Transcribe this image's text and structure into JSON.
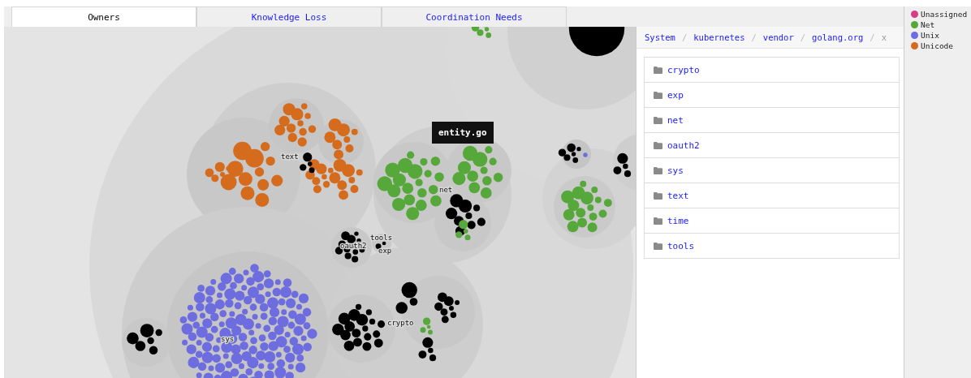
{
  "tabs": [
    {
      "label": "Owners",
      "selected": true
    },
    {
      "label": "Knowledge Loss",
      "selected": false
    },
    {
      "label": "Coordination Needs",
      "selected": false
    }
  ],
  "canvas": {
    "clusters": [
      {
        "color": "#d56b1c"
      },
      {
        "color": "#d56b1c"
      },
      {
        "color": "#d56b1c"
      },
      {
        "color": "#d56b1c"
      },
      {
        "color": "#d56b1c"
      },
      {
        "color": "#d56b1c"
      },
      {
        "color": "#000000"
      },
      {
        "color": "#56a83a"
      },
      {
        "color": "#56a83a"
      },
      {
        "color": "#000000"
      },
      {
        "color": "#56a83a"
      },
      {
        "color": "#000000"
      },
      {
        "color": "#000000"
      },
      {
        "color": "#6d6de0"
      },
      {
        "color": "#000000"
      },
      {
        "color": "#000000"
      },
      {
        "color": "#000000"
      },
      {
        "color": "#000000"
      },
      {
        "color": "#56a83a"
      },
      {
        "color": "#000000"
      },
      {
        "color": "#000000"
      },
      {
        "color": "#56a83a"
      },
      {
        "color": "#000000"
      },
      {
        "color": "#56a83a"
      },
      {
        "color": "#000000"
      },
      {
        "color": "#6d6de0"
      }
    ],
    "labels": [
      "text",
      "net",
      "oauth2",
      "tools",
      "exp",
      "crypto",
      "sys"
    ],
    "tooltip": "entity.go"
  },
  "breadcrumb": {
    "items": [
      "System",
      "kubernetes",
      "vendor",
      "golang.org"
    ],
    "separator": "/",
    "close": "x"
  },
  "folders": [
    "crypto",
    "exp",
    "net",
    "oauth2",
    "sys",
    "text",
    "time",
    "tools"
  ],
  "legend": [
    {
      "name": "Unassigned",
      "color": "#d63d86"
    },
    {
      "name": "Net",
      "color": "#56a83a"
    },
    {
      "name": "Unix",
      "color": "#6d6de0"
    },
    {
      "name": "Unicode",
      "color": "#d56b1c"
    }
  ]
}
